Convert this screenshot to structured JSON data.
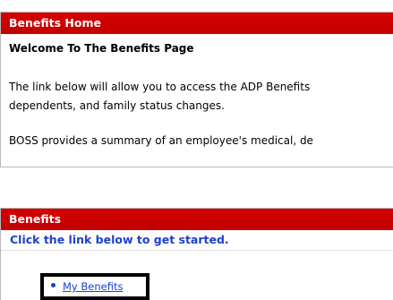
{
  "home_panel": {
    "header": "Benefits Home",
    "welcome": "Welcome To The Benefits Page",
    "intro_line1": "The link below will allow you to access the ADP Benefits",
    "intro_line2": "dependents, and family status changes.",
    "boss_text": "BOSS provides a summary of an employee's medical, de"
  },
  "benefits_panel": {
    "header": "Benefits",
    "subheader": "Click the link below to get started.",
    "links": [
      {
        "label": "My Benefits"
      }
    ]
  },
  "colors": {
    "header_red": "#cc0000",
    "link_blue": "#1c3fd0"
  }
}
